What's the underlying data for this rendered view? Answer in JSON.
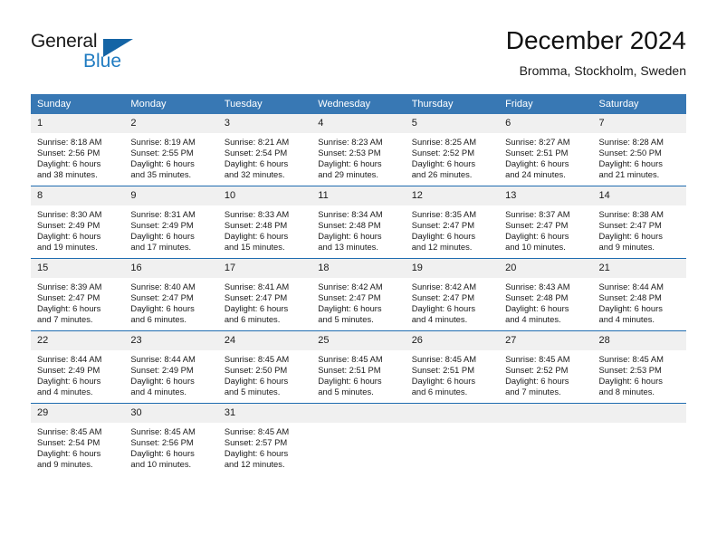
{
  "logo": {
    "text_top": "General",
    "text_bottom": "Blue",
    "triangle_color": "#1464a5",
    "blue_color": "#1f7bc1"
  },
  "header": {
    "title": "December 2024",
    "subtitle": "Bromma, Stockholm, Sweden"
  },
  "colors": {
    "header_row_bg": "#3878b4",
    "header_row_text": "#ffffff",
    "daynum_band_bg": "#f0f0f0",
    "week_separator": "#1f6cb0",
    "cell_bg": "#ffffff",
    "body_text": "#1a1a1a"
  },
  "weekdays": [
    "Sunday",
    "Monday",
    "Tuesday",
    "Wednesday",
    "Thursday",
    "Friday",
    "Saturday"
  ],
  "weeks": [
    [
      {
        "day": "1",
        "sunrise": "Sunrise: 8:18 AM",
        "sunset": "Sunset: 2:56 PM",
        "daylight_1": "Daylight: 6 hours",
        "daylight_2": "and 38 minutes."
      },
      {
        "day": "2",
        "sunrise": "Sunrise: 8:19 AM",
        "sunset": "Sunset: 2:55 PM",
        "daylight_1": "Daylight: 6 hours",
        "daylight_2": "and 35 minutes."
      },
      {
        "day": "3",
        "sunrise": "Sunrise: 8:21 AM",
        "sunset": "Sunset: 2:54 PM",
        "daylight_1": "Daylight: 6 hours",
        "daylight_2": "and 32 minutes."
      },
      {
        "day": "4",
        "sunrise": "Sunrise: 8:23 AM",
        "sunset": "Sunset: 2:53 PM",
        "daylight_1": "Daylight: 6 hours",
        "daylight_2": "and 29 minutes."
      },
      {
        "day": "5",
        "sunrise": "Sunrise: 8:25 AM",
        "sunset": "Sunset: 2:52 PM",
        "daylight_1": "Daylight: 6 hours",
        "daylight_2": "and 26 minutes."
      },
      {
        "day": "6",
        "sunrise": "Sunrise: 8:27 AM",
        "sunset": "Sunset: 2:51 PM",
        "daylight_1": "Daylight: 6 hours",
        "daylight_2": "and 24 minutes."
      },
      {
        "day": "7",
        "sunrise": "Sunrise: 8:28 AM",
        "sunset": "Sunset: 2:50 PM",
        "daylight_1": "Daylight: 6 hours",
        "daylight_2": "and 21 minutes."
      }
    ],
    [
      {
        "day": "8",
        "sunrise": "Sunrise: 8:30 AM",
        "sunset": "Sunset: 2:49 PM",
        "daylight_1": "Daylight: 6 hours",
        "daylight_2": "and 19 minutes."
      },
      {
        "day": "9",
        "sunrise": "Sunrise: 8:31 AM",
        "sunset": "Sunset: 2:49 PM",
        "daylight_1": "Daylight: 6 hours",
        "daylight_2": "and 17 minutes."
      },
      {
        "day": "10",
        "sunrise": "Sunrise: 8:33 AM",
        "sunset": "Sunset: 2:48 PM",
        "daylight_1": "Daylight: 6 hours",
        "daylight_2": "and 15 minutes."
      },
      {
        "day": "11",
        "sunrise": "Sunrise: 8:34 AM",
        "sunset": "Sunset: 2:48 PM",
        "daylight_1": "Daylight: 6 hours",
        "daylight_2": "and 13 minutes."
      },
      {
        "day": "12",
        "sunrise": "Sunrise: 8:35 AM",
        "sunset": "Sunset: 2:47 PM",
        "daylight_1": "Daylight: 6 hours",
        "daylight_2": "and 12 minutes."
      },
      {
        "day": "13",
        "sunrise": "Sunrise: 8:37 AM",
        "sunset": "Sunset: 2:47 PM",
        "daylight_1": "Daylight: 6 hours",
        "daylight_2": "and 10 minutes."
      },
      {
        "day": "14",
        "sunrise": "Sunrise: 8:38 AM",
        "sunset": "Sunset: 2:47 PM",
        "daylight_1": "Daylight: 6 hours",
        "daylight_2": "and 9 minutes."
      }
    ],
    [
      {
        "day": "15",
        "sunrise": "Sunrise: 8:39 AM",
        "sunset": "Sunset: 2:47 PM",
        "daylight_1": "Daylight: 6 hours",
        "daylight_2": "and 7 minutes."
      },
      {
        "day": "16",
        "sunrise": "Sunrise: 8:40 AM",
        "sunset": "Sunset: 2:47 PM",
        "daylight_1": "Daylight: 6 hours",
        "daylight_2": "and 6 minutes."
      },
      {
        "day": "17",
        "sunrise": "Sunrise: 8:41 AM",
        "sunset": "Sunset: 2:47 PM",
        "daylight_1": "Daylight: 6 hours",
        "daylight_2": "and 6 minutes."
      },
      {
        "day": "18",
        "sunrise": "Sunrise: 8:42 AM",
        "sunset": "Sunset: 2:47 PM",
        "daylight_1": "Daylight: 6 hours",
        "daylight_2": "and 5 minutes."
      },
      {
        "day": "19",
        "sunrise": "Sunrise: 8:42 AM",
        "sunset": "Sunset: 2:47 PM",
        "daylight_1": "Daylight: 6 hours",
        "daylight_2": "and 4 minutes."
      },
      {
        "day": "20",
        "sunrise": "Sunrise: 8:43 AM",
        "sunset": "Sunset: 2:48 PM",
        "daylight_1": "Daylight: 6 hours",
        "daylight_2": "and 4 minutes."
      },
      {
        "day": "21",
        "sunrise": "Sunrise: 8:44 AM",
        "sunset": "Sunset: 2:48 PM",
        "daylight_1": "Daylight: 6 hours",
        "daylight_2": "and 4 minutes."
      }
    ],
    [
      {
        "day": "22",
        "sunrise": "Sunrise: 8:44 AM",
        "sunset": "Sunset: 2:49 PM",
        "daylight_1": "Daylight: 6 hours",
        "daylight_2": "and 4 minutes."
      },
      {
        "day": "23",
        "sunrise": "Sunrise: 8:44 AM",
        "sunset": "Sunset: 2:49 PM",
        "daylight_1": "Daylight: 6 hours",
        "daylight_2": "and 4 minutes."
      },
      {
        "day": "24",
        "sunrise": "Sunrise: 8:45 AM",
        "sunset": "Sunset: 2:50 PM",
        "daylight_1": "Daylight: 6 hours",
        "daylight_2": "and 5 minutes."
      },
      {
        "day": "25",
        "sunrise": "Sunrise: 8:45 AM",
        "sunset": "Sunset: 2:51 PM",
        "daylight_1": "Daylight: 6 hours",
        "daylight_2": "and 5 minutes."
      },
      {
        "day": "26",
        "sunrise": "Sunrise: 8:45 AM",
        "sunset": "Sunset: 2:51 PM",
        "daylight_1": "Daylight: 6 hours",
        "daylight_2": "and 6 minutes."
      },
      {
        "day": "27",
        "sunrise": "Sunrise: 8:45 AM",
        "sunset": "Sunset: 2:52 PM",
        "daylight_1": "Daylight: 6 hours",
        "daylight_2": "and 7 minutes."
      },
      {
        "day": "28",
        "sunrise": "Sunrise: 8:45 AM",
        "sunset": "Sunset: 2:53 PM",
        "daylight_1": "Daylight: 6 hours",
        "daylight_2": "and 8 minutes."
      }
    ],
    [
      {
        "day": "29",
        "sunrise": "Sunrise: 8:45 AM",
        "sunset": "Sunset: 2:54 PM",
        "daylight_1": "Daylight: 6 hours",
        "daylight_2": "and 9 minutes."
      },
      {
        "day": "30",
        "sunrise": "Sunrise: 8:45 AM",
        "sunset": "Sunset: 2:56 PM",
        "daylight_1": "Daylight: 6 hours",
        "daylight_2": "and 10 minutes."
      },
      {
        "day": "31",
        "sunrise": "Sunrise: 8:45 AM",
        "sunset": "Sunset: 2:57 PM",
        "daylight_1": "Daylight: 6 hours",
        "daylight_2": "and 12 minutes."
      },
      {
        "day": "",
        "sunrise": "",
        "sunset": "",
        "daylight_1": "",
        "daylight_2": ""
      },
      {
        "day": "",
        "sunrise": "",
        "sunset": "",
        "daylight_1": "",
        "daylight_2": ""
      },
      {
        "day": "",
        "sunrise": "",
        "sunset": "",
        "daylight_1": "",
        "daylight_2": ""
      },
      {
        "day": "",
        "sunrise": "",
        "sunset": "",
        "daylight_1": "",
        "daylight_2": ""
      }
    ]
  ]
}
